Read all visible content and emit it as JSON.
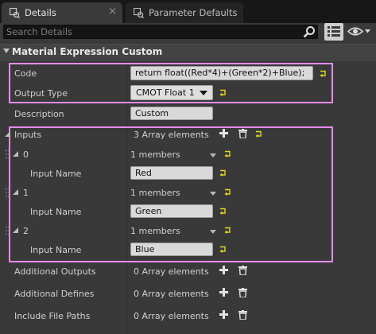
{
  "tabs": [
    {
      "label": "Details",
      "icon": "details-icon",
      "close": "×"
    },
    {
      "label": "Parameter Defaults",
      "icon": "parameter-icon"
    }
  ],
  "search": {
    "placeholder": "Search Details"
  },
  "category": {
    "title": "Material Expression Custom"
  },
  "properties": {
    "code": {
      "label": "Code",
      "value": "return float((Red*4)+(Green*2)+Blue);"
    },
    "output_type": {
      "label": "Output Type",
      "value": "CMOT Float 1"
    },
    "description": {
      "label": "Description",
      "value": "Custom"
    },
    "inputs": {
      "label": "Inputs",
      "count": "3 Array elements",
      "elements": [
        {
          "index": "0",
          "members": "1 members",
          "field_label": "Input Name",
          "value": "Red"
        },
        {
          "index": "1",
          "members": "1 members",
          "field_label": "Input Name",
          "value": "Green"
        },
        {
          "index": "2",
          "members": "1 members",
          "field_label": "Input Name",
          "value": "Blue"
        }
      ]
    },
    "additional_outputs": {
      "label": "Additional Outputs",
      "count": "0 Array elements"
    },
    "additional_defines": {
      "label": "Additional Defines",
      "count": "0 Array elements"
    },
    "include_file_paths": {
      "label": "Include File Paths",
      "count": "0 Array elements"
    }
  },
  "colors": {
    "highlight": "#e68bea",
    "reset_arrow": "#e3d62b",
    "panel": "#393939",
    "field": "#d9d9d9"
  },
  "icons": {
    "search": "search-icon",
    "view_options": "view-options-icon",
    "add": "plus-icon",
    "delete": "trash-icon",
    "reset": "reset-to-default-icon",
    "expand": "expand-arrow-icon",
    "dropdown": "dropdown-arrow-icon",
    "drag": "drag-handle-icon"
  }
}
